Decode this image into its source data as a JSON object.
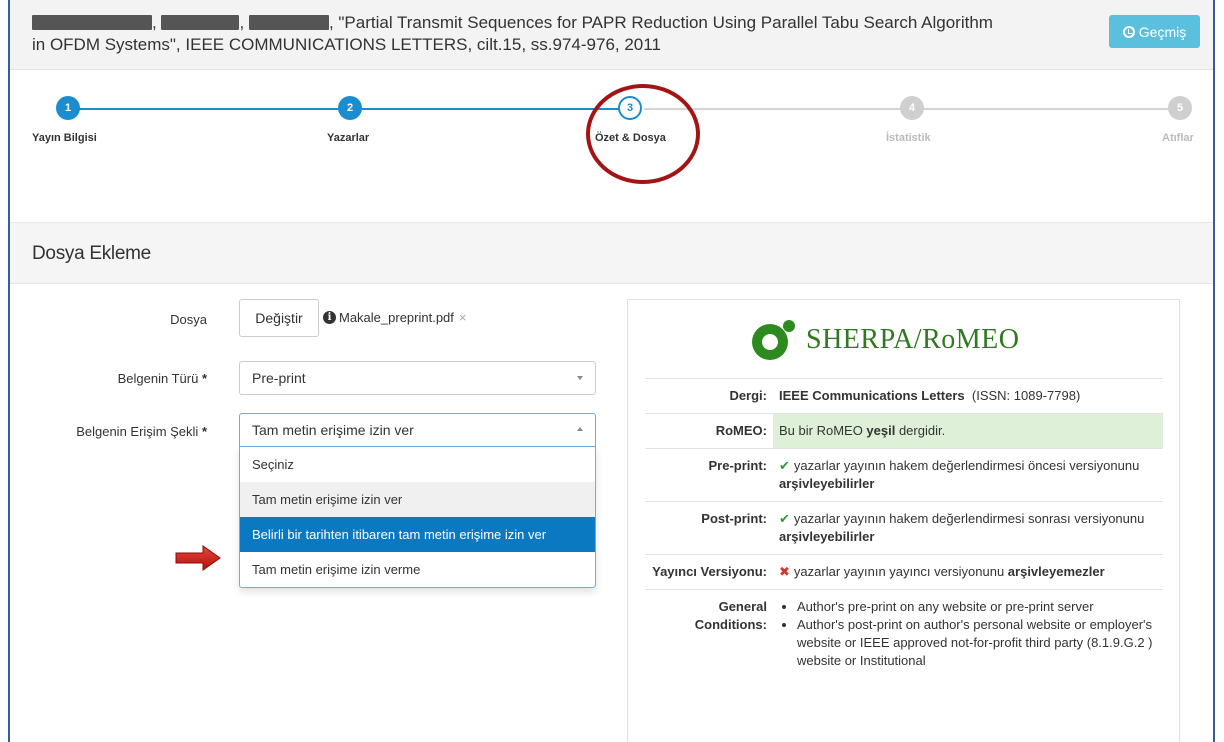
{
  "header": {
    "title_rest_line1": ", \"Partial Transmit Sequences for PAPR Reduction Using Parallel Tabu Search Algorithm",
    "title_line2": "in OFDM Systems\", IEEE COMMUNICATIONS LETTERS, cilt.15, ss.974-976, 2011",
    "history_button": "Geçmiş",
    "separator_1": ",",
    "separator_2": ","
  },
  "wizard": {
    "steps": [
      {
        "number": "1",
        "label": "Yayın Bilgisi",
        "state": "done"
      },
      {
        "number": "2",
        "label": "Yazarlar",
        "state": "done"
      },
      {
        "number": "3",
        "label": "Özet & Dosya",
        "state": "current"
      },
      {
        "number": "4",
        "label": "İstatistik",
        "state": "todo"
      },
      {
        "number": "5",
        "label": "Atıflar",
        "state": "todo"
      }
    ]
  },
  "panel": {
    "title": "Dosya Ekleme"
  },
  "form": {
    "file_label": "Dosya",
    "change_button": "Değiştir",
    "file_name": "Makale_preprint.pdf",
    "remove_symbol": "×",
    "doc_type_label": "Belgenin Türü",
    "doc_type_value": "Pre-print",
    "access_label": "Belgenin Erişim Şekli",
    "access_value": "Tam metin erişime izin ver",
    "required_mark": "*",
    "access_options": [
      "Seçiniz",
      "Tam metin erişime izin ver",
      "Belirli bir tarihten itibaren tam metin erişime izin ver",
      "Tam metin erişime izin verme"
    ]
  },
  "sherpa": {
    "logo_text": "SHERPA/RoMEO",
    "rows": {
      "journal_key": "Dergi:",
      "journal_name": "IEEE Communications Letters",
      "journal_issn": "(ISSN: 1089-7798)",
      "romeo_key": "RoMEO:",
      "romeo_pre": "Bu bir RoMEO ",
      "romeo_bold": "yeşil",
      "romeo_post": " dergidir.",
      "preprint_key": "Pre-print:",
      "preprint_text": "yazarlar yayının hakem değerlendirmesi öncesi versiyonunu ",
      "preprint_bold": "arşivleyebilirler",
      "postprint_key": "Post-print:",
      "postprint_text": "yazarlar yayının hakem değerlendirmesi sonrası versiyonunu ",
      "postprint_bold": "arşivleyebilirler",
      "publisher_key": "Yayıncı Versiyonu:",
      "publisher_text": "yazarlar yayının yayıncı versiyonunu ",
      "publisher_bold": "arşivleyemezler",
      "conditions_key": "General Conditions:",
      "conditions": [
        "Author's pre-print on any website or pre-print server",
        "Author's post-print on author's personal website or employer's website or IEEE approved not-for-profit third party (8.1.9.G.2 ) website or Institutional"
      ]
    }
  },
  "colors": {
    "primary": "#1a8dd0",
    "selected_option": "#0b79c2",
    "romeo_green_bg": "#dff0d8",
    "annotation_red": "#a31515",
    "history_button_bg": "#5bc0de"
  }
}
